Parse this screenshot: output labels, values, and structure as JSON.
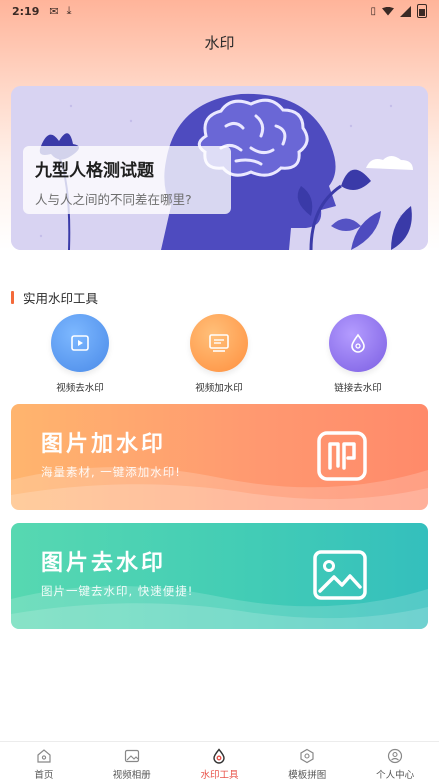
{
  "status_bar": {
    "time": "2:19",
    "icons": [
      "notification-icon",
      "download-icon",
      "vibrate-icon",
      "wifi-icon",
      "signal-icon",
      "battery-icon"
    ]
  },
  "header": {
    "title": "水印"
  },
  "banner": {
    "title": "九型人格测试题",
    "subtitle": "人与人之间的不同差在哪里?"
  },
  "section": {
    "title": "实用水印工具"
  },
  "tools": [
    {
      "label": "视频去水印",
      "icon": "play-icon",
      "color": "#4f93ef"
    },
    {
      "label": "视频加水印",
      "icon": "video-frame-icon",
      "color": "#ff9a4c"
    },
    {
      "label": "链接去水印",
      "icon": "water-drop-icon",
      "color": "#8a6de8"
    }
  ],
  "cards": {
    "add": {
      "title": "图片加水印",
      "subtitle": "海量素材, 一键添加水印!",
      "icon": "stamp-icon"
    },
    "remove": {
      "title": "图片去水印",
      "subtitle": "图片一键去水印, 快速便捷!",
      "icon": "image-icon"
    }
  },
  "bottom_nav": [
    {
      "label": "首页",
      "icon": "home-icon",
      "active": false
    },
    {
      "label": "视频相册",
      "icon": "album-icon",
      "active": false
    },
    {
      "label": "水印工具",
      "icon": "watermark-icon",
      "active": true
    },
    {
      "label": "模板拼图",
      "icon": "template-icon",
      "active": false
    },
    {
      "label": "个人中心",
      "icon": "profile-icon",
      "active": false
    }
  ],
  "colors": {
    "accent": "#e8534a",
    "section_bar": "#f46a3a"
  }
}
